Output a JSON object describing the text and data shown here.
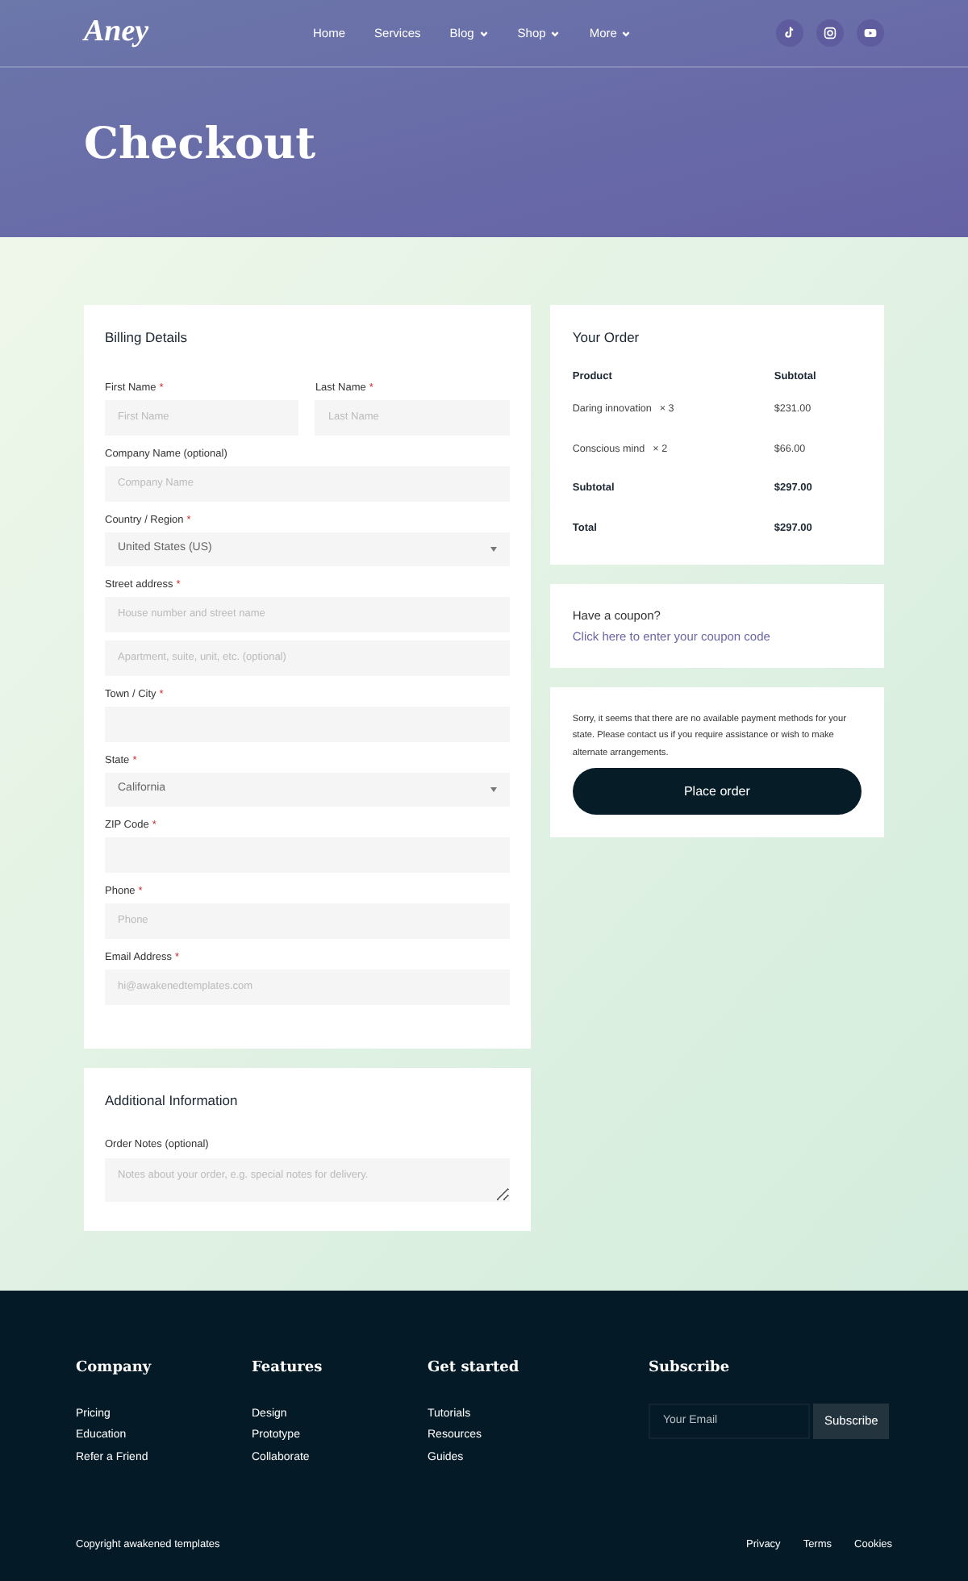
{
  "header": {
    "logo": "Aney",
    "nav": [
      {
        "label": "Home",
        "has_menu": false
      },
      {
        "label": "Services",
        "has_menu": false
      },
      {
        "label": "Blog",
        "has_menu": true
      },
      {
        "label": "Shop",
        "has_menu": true
      },
      {
        "label": "More",
        "has_menu": true
      }
    ],
    "social": [
      {
        "kind": "tiktok"
      },
      {
        "kind": "instagram"
      },
      {
        "kind": "youtube"
      }
    ],
    "title": "Checkout"
  },
  "billing": {
    "title": "Billing Details",
    "rows": [
      {
        "fields": [
          {
            "label": "First Name",
            "required_mark": "*",
            "kind": "text",
            "placeholder": "First Name"
          },
          {
            "label": "Last Name",
            "required_mark": "*",
            "kind": "text",
            "placeholder": "Last Name"
          }
        ]
      },
      {
        "fields": [
          {
            "label": "Company Name (optional)",
            "kind": "text",
            "placeholder": "Company Name"
          }
        ]
      },
      {
        "fields": [
          {
            "label": "Country / Region",
            "required_mark": "*",
            "kind": "select",
            "value": "United States (US)"
          }
        ]
      },
      {
        "fields": [
          {
            "label": "Street address",
            "required_mark": "*",
            "kind": "text",
            "placeholder": "House number and street name"
          }
        ]
      },
      {
        "fields": [
          {
            "kind": "text",
            "placeholder": "Apartment, suite, unit, etc. (optional)"
          }
        ]
      },
      {
        "fields": [
          {
            "label": "Town / City",
            "required_mark": "*",
            "kind": "text"
          }
        ]
      },
      {
        "fields": [
          {
            "label": "State",
            "required_mark": "*",
            "kind": "select",
            "value": "California"
          }
        ]
      },
      {
        "fields": [
          {
            "label": "ZIP Code",
            "required_mark": "*",
            "kind": "text"
          }
        ]
      },
      {
        "fields": [
          {
            "label": "Phone",
            "required_mark": "*",
            "kind": "text",
            "placeholder": "Phone"
          }
        ]
      },
      {
        "fields": [
          {
            "label": "Email Address",
            "required_mark": "*",
            "kind": "text",
            "placeholder": "hi@awakenedtemplates.com"
          }
        ]
      }
    ]
  },
  "additional": {
    "title": "Additional Information",
    "label": "Order Notes (optional)",
    "placeholder": "Notes about your order, e.g. special notes for delivery."
  },
  "order": {
    "title": "Your Order",
    "columns": [
      "Product",
      "Subtotal"
    ],
    "rows": [
      {
        "kind": "item",
        "product": "Daring innovation",
        "quantity": "× 3",
        "amount": "$231.00"
      },
      {
        "kind": "item",
        "product": "Conscious mind",
        "quantity": "× 2",
        "amount": "$66.00"
      },
      {
        "kind": "summary",
        "product": "Subtotal",
        "amount": "$297.00"
      },
      {
        "kind": "summary",
        "product": "Total",
        "amount": "$297.00"
      }
    ]
  },
  "coupon": {
    "text": "Have a coupon?",
    "link": "Click here to enter your coupon code"
  },
  "payment": {
    "message": "Sorry, it seems that there are no available payment methods for your state. Please contact us if you require assistance or wish to make alternate arrangements.",
    "button": "Place order"
  },
  "footer": {
    "columns": [
      {
        "title": "Company",
        "links": [
          "Pricing",
          "Education",
          "Refer a Friend"
        ]
      },
      {
        "title": "Features",
        "links": [
          "Design",
          "Prototype",
          "Collaborate"
        ]
      },
      {
        "title": "Get started",
        "links": [
          "Tutorials",
          "Resources",
          "Guides"
        ]
      }
    ],
    "subscribe": {
      "title": "Subscribe",
      "placeholder": "Your Email",
      "button": "Subscribe"
    },
    "copyright": "Copyright awakened templates",
    "legal": [
      "Privacy",
      "Terms",
      "Cookies"
    ]
  }
}
